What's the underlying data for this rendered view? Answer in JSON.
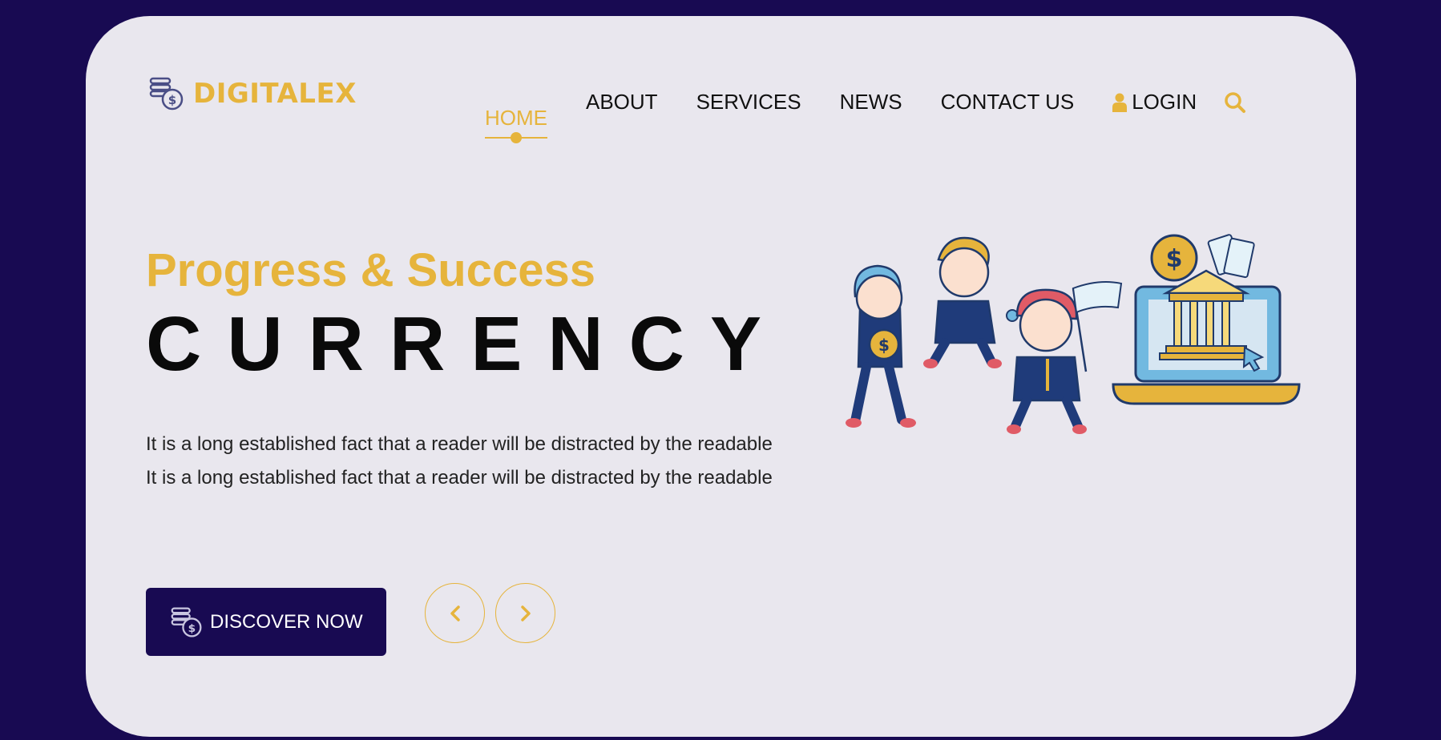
{
  "brand": {
    "name": "DIGITALEX",
    "accent": "#e6b43c",
    "dark": "#180a52"
  },
  "nav": {
    "items": [
      {
        "label": "HOME",
        "active": true
      },
      {
        "label": "ABOUT"
      },
      {
        "label": "SERVICES"
      },
      {
        "label": "NEWS"
      },
      {
        "label": "CONTACT US"
      },
      {
        "label": "LOGIN",
        "icon": "user-icon"
      }
    ],
    "search_icon": "search-icon"
  },
  "hero": {
    "tagline": "Progress & Success",
    "headline": "CURRENCY",
    "description": "It is a long established fact that a reader will be distracted by the readable It is a long established fact that a reader will be distracted by the readable",
    "cta_label": "DISCOVER NOW",
    "prev_icon": "chevron-left-icon",
    "next_icon": "chevron-right-icon"
  }
}
